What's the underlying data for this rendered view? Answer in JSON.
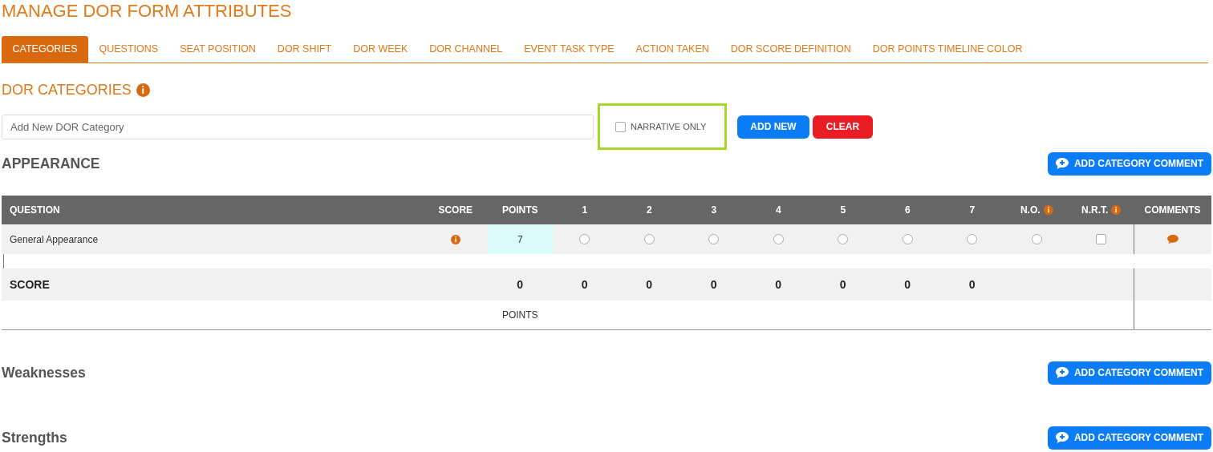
{
  "page_title": "MANAGE DOR FORM ATTRIBUTES",
  "tabs": [
    {
      "label": "CATEGORIES",
      "selected": true
    },
    {
      "label": "QUESTIONS",
      "selected": false
    },
    {
      "label": "SEAT POSITION",
      "selected": false
    },
    {
      "label": "DOR SHIFT",
      "selected": false
    },
    {
      "label": "DOR WEEK",
      "selected": false
    },
    {
      "label": "DOR CHANNEL",
      "selected": false
    },
    {
      "label": "EVENT TASK TYPE",
      "selected": false
    },
    {
      "label": "ACTION TAKEN",
      "selected": false
    },
    {
      "label": "DOR SCORE DEFINITION",
      "selected": false
    },
    {
      "label": "DOR POINTS TIMELINE COLOR",
      "selected": false
    }
  ],
  "section_title": "DOR CATEGORIES",
  "new_category": {
    "placeholder": "Add New DOR Category",
    "narrative_only": {
      "label": "NARRATIVE ONLY",
      "checked": false
    },
    "add_button": "ADD NEW",
    "clear_button": "CLEAR"
  },
  "categories": [
    {
      "name": "APPEARANCE",
      "comment_button": "ADD CATEGORY COMMENT",
      "table": {
        "columns": [
          {
            "label": "QUESTION",
            "info": false
          },
          {
            "label": "SCORE",
            "info": false
          },
          {
            "label": "POINTS",
            "info": false
          },
          {
            "label": "1",
            "info": false
          },
          {
            "label": "2",
            "info": false
          },
          {
            "label": "3",
            "info": false
          },
          {
            "label": "4",
            "info": false
          },
          {
            "label": "5",
            "info": false
          },
          {
            "label": "6",
            "info": false
          },
          {
            "label": "7",
            "info": false
          },
          {
            "label": "N.O.",
            "info": true
          },
          {
            "label": "N.R.T.",
            "info": true
          },
          {
            "label": "COMMENTS",
            "info": false
          }
        ],
        "rows": [
          {
            "question": "General Appearance",
            "points": "7",
            "choices": [
              {
                "selected": false
              },
              {
                "selected": false
              },
              {
                "selected": false
              },
              {
                "selected": false
              },
              {
                "selected": false
              },
              {
                "selected": false
              },
              {
                "selected": false
              },
              {
                "selected": false
              }
            ],
            "nrt_checked": false
          }
        ],
        "score_label": "SCORE",
        "score_values": [
          "0",
          "0",
          "0",
          "0",
          "0",
          "0",
          "0",
          "0"
        ],
        "points_label": "POINTS"
      }
    },
    {
      "name": "Weaknesses",
      "comment_button": "ADD CATEGORY COMMENT"
    },
    {
      "name": "Strengths",
      "comment_button": "ADD CATEGORY COMMENT"
    }
  ]
}
